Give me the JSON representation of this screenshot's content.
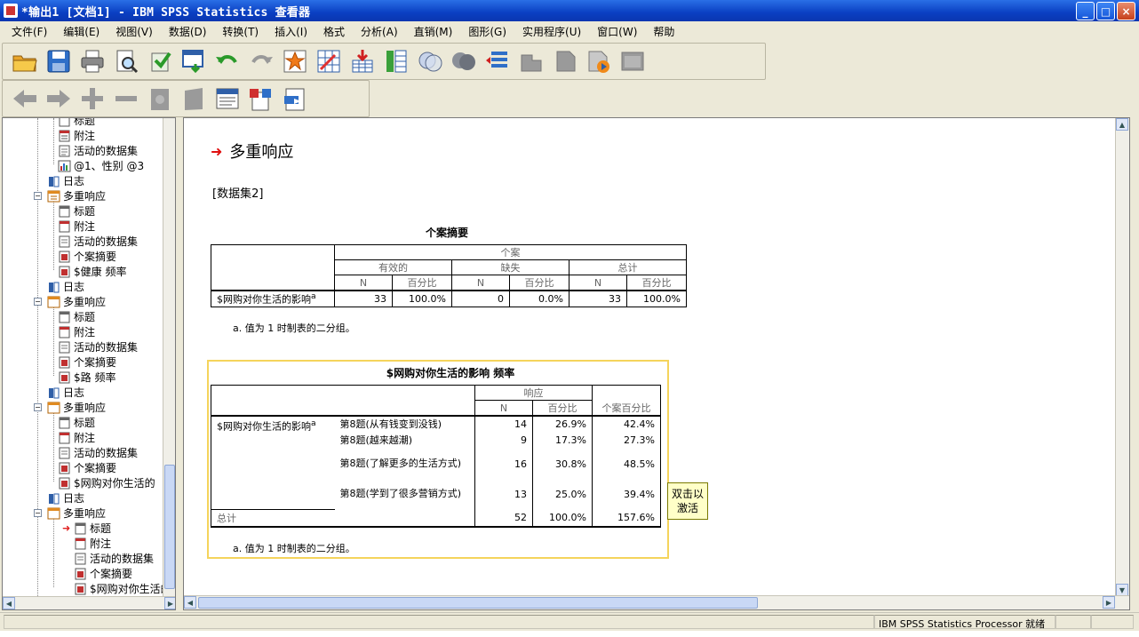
{
  "window": {
    "title": "*输出1 [文档1] - IBM SPSS Statistics 查看器",
    "minimize": "_",
    "maximize": "□",
    "close": "×"
  },
  "menu": [
    "文件(F)",
    "编辑(E)",
    "视图(V)",
    "数据(D)",
    "转换(T)",
    "插入(I)",
    "格式",
    "分析(A)",
    "直销(M)",
    "图形(G)",
    "实用程序(U)",
    "窗口(W)",
    "帮助"
  ],
  "outline": {
    "items": [
      {
        "label": "标题"
      },
      {
        "label": "附注"
      },
      {
        "label": "活动的数据集"
      },
      {
        "label": "@1、性别 @3"
      },
      {
        "label": "日志"
      },
      {
        "label": "多重响应"
      },
      {
        "label": "标题"
      },
      {
        "label": "附注"
      },
      {
        "label": "活动的数据集"
      },
      {
        "label": "个案摘要"
      },
      {
        "label": "$健康 频率"
      },
      {
        "label": "日志"
      },
      {
        "label": "多重响应"
      },
      {
        "label": "标题"
      },
      {
        "label": "附注"
      },
      {
        "label": "活动的数据集"
      },
      {
        "label": "个案摘要"
      },
      {
        "label": "$路 频率"
      },
      {
        "label": "日志"
      },
      {
        "label": "多重响应"
      },
      {
        "label": "标题"
      },
      {
        "label": "附注"
      },
      {
        "label": "活动的数据集"
      },
      {
        "label": "个案摘要"
      },
      {
        "label": "$网购对你生活的"
      },
      {
        "label": "日志"
      },
      {
        "label": "多重响应"
      },
      {
        "label": "标题"
      },
      {
        "label": "附注"
      },
      {
        "label": "活动的数据集"
      },
      {
        "label": "个案摘要"
      },
      {
        "label": "$网购对你生活的"
      }
    ]
  },
  "content": {
    "heading": "多重响应",
    "dataset": "[数据集2]",
    "case_summary": {
      "caption": "个案摘要",
      "group_header": "个案",
      "col_groups": [
        "有效的",
        "缺失",
        "总计"
      ],
      "n_label": "N",
      "pct_label": "百分比",
      "row_label": "$网购对你生活的影响",
      "row_sup": "a",
      "values": [
        "33",
        "100.0%",
        "0",
        "0.0%",
        "33",
        "100.0%"
      ],
      "footnote": "a. 值为 1 时制表的二分组。"
    },
    "freq_table": {
      "caption": "$网购对你生活的影响 频率",
      "response_header": "响应",
      "n_label": "N",
      "pct_label": "百分比",
      "case_pct_label": "个案百分比",
      "row_group": "$网购对你生活的影响",
      "row_sup": "a",
      "rows": [
        {
          "label": "第8题(从有钱变到没钱)",
          "n": "14",
          "pct": "26.9%",
          "case_pct": "42.4%"
        },
        {
          "label": "第8题(越来越潮)",
          "n": "9",
          "pct": "17.3%",
          "case_pct": "27.3%"
        },
        {
          "label": "第8题(了解更多的生活方式)",
          "n": "16",
          "pct": "30.8%",
          "case_pct": "48.5%"
        },
        {
          "label": "第8题(学到了很多营销方式)",
          "n": "13",
          "pct": "25.0%",
          "case_pct": "39.4%"
        }
      ],
      "total_label": "总计",
      "total": {
        "n": "52",
        "pct": "100.0%",
        "case_pct": "157.6%"
      },
      "footnote": "a. 值为 1 时制表的二分组。"
    },
    "tooltip": "双击以激活"
  },
  "status": {
    "processor": "IBM SPSS Statistics Processor 就绪"
  }
}
